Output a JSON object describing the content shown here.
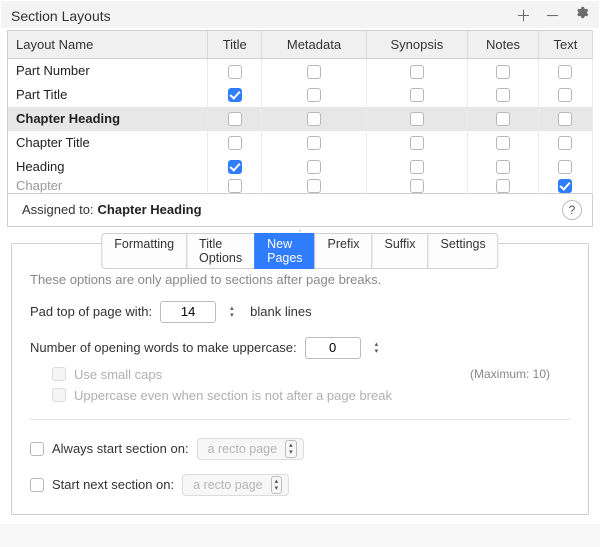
{
  "header": {
    "title": "Section Layouts"
  },
  "columns": [
    "Layout Name",
    "Title",
    "Metadata",
    "Synopsis",
    "Notes",
    "Text"
  ],
  "rows": [
    {
      "name": "Part Number",
      "title": false,
      "metadata": false,
      "synopsis": false,
      "notes": false,
      "text": false,
      "selected": false
    },
    {
      "name": "Part Title",
      "title": true,
      "metadata": false,
      "synopsis": false,
      "notes": false,
      "text": false,
      "selected": false
    },
    {
      "name": "Chapter Heading",
      "title": false,
      "metadata": false,
      "synopsis": false,
      "notes": false,
      "text": false,
      "selected": true
    },
    {
      "name": "Chapter Title",
      "title": false,
      "metadata": false,
      "synopsis": false,
      "notes": false,
      "text": false,
      "selected": false
    },
    {
      "name": "Heading",
      "title": true,
      "metadata": false,
      "synopsis": false,
      "notes": false,
      "text": false,
      "selected": false
    },
    {
      "name": "Chapter",
      "title": false,
      "metadata": false,
      "synopsis": false,
      "notes": false,
      "text": true,
      "selected": false,
      "cutoff": true
    }
  ],
  "assigned": {
    "label": "Assigned to:",
    "value": "Chapter Heading"
  },
  "tabs": [
    "Formatting",
    "Title Options",
    "New Pages",
    "Prefix",
    "Suffix",
    "Settings"
  ],
  "activeTab": 2,
  "pane": {
    "note": "These options are only applied to sections after page breaks.",
    "pad_label": "Pad top of page with:",
    "pad_value": "14",
    "pad_suffix": "blank lines",
    "words_label": "Number of opening words to make uppercase:",
    "words_value": "0",
    "max_note": "(Maximum: 10)",
    "smallcaps_label": "Use small caps",
    "uppercase_always_label": "Uppercase even when section is not after a page break",
    "always_start_label": "Always start section on:",
    "start_next_label": "Start next section on:",
    "recto_option": "a recto page"
  }
}
